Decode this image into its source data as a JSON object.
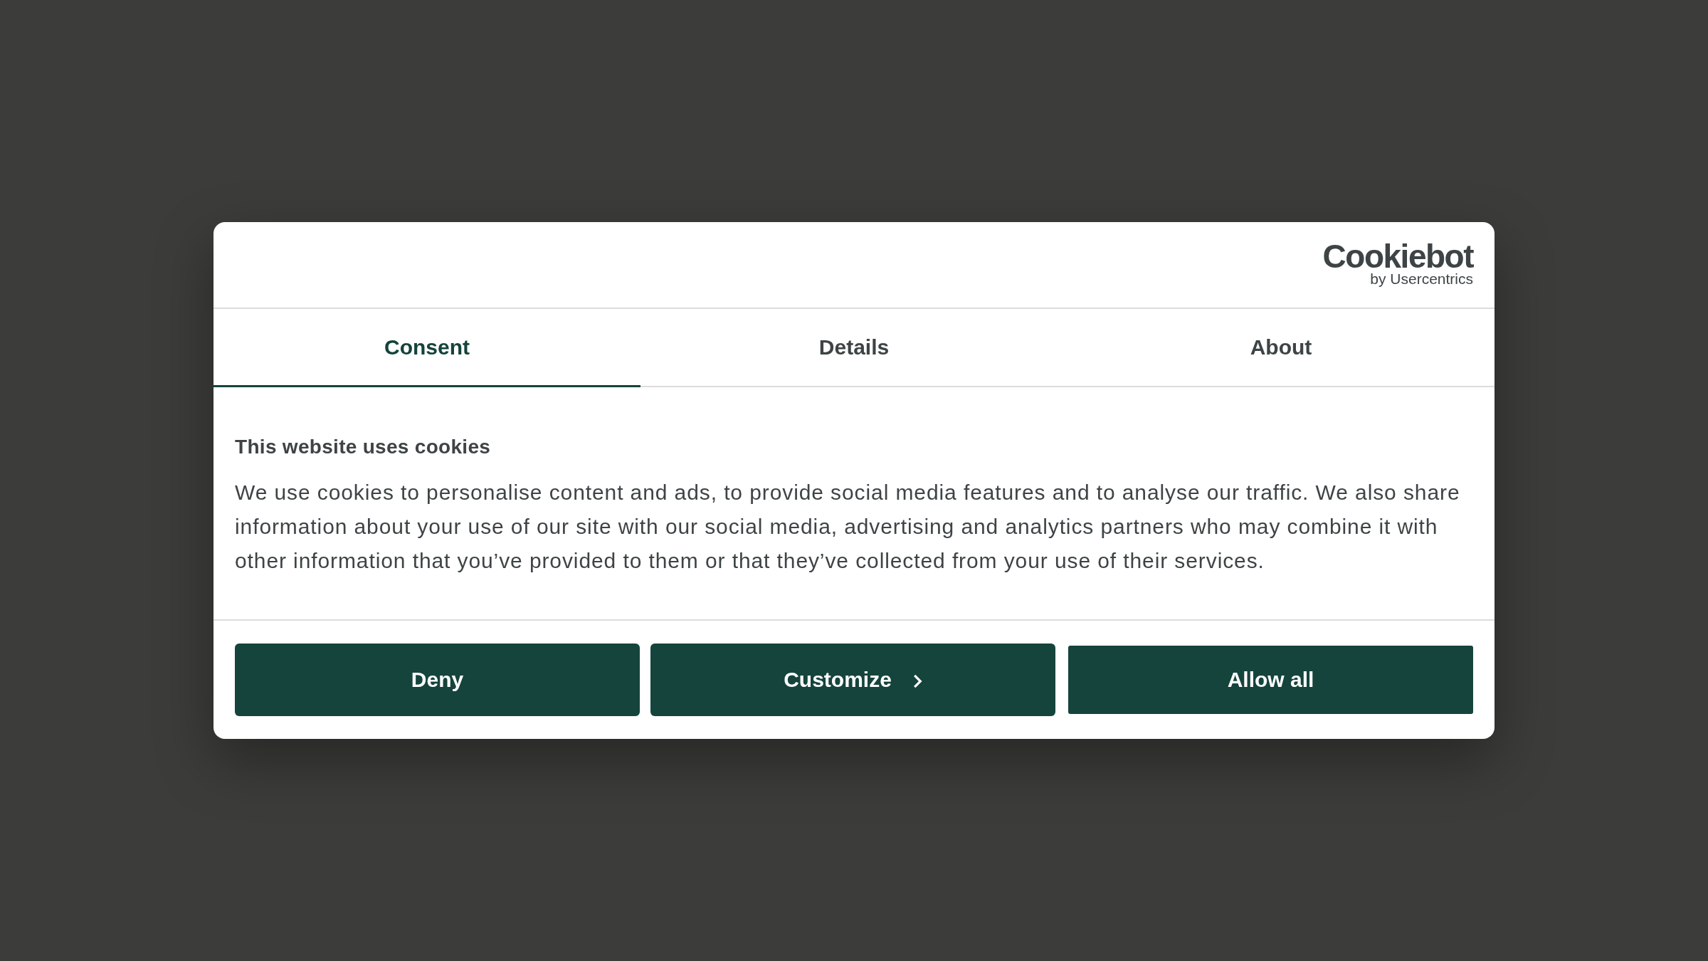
{
  "logo": {
    "wordmark": "Cookiebot",
    "tagline": "by Usercentrics"
  },
  "tabs": [
    {
      "label": "Consent",
      "selected": true
    },
    {
      "label": "Details",
      "selected": false
    },
    {
      "label": "About",
      "selected": false
    }
  ],
  "content": {
    "heading": "This website uses cookies",
    "body": "We use cookies to personalise content and ads, to provide social media features and to analyse our traffic. We also share information about your use of our site with our social media, advertising and analytics partners who may combine it with other information that you’ve provided to them or that they’ve collected from your use of their services."
  },
  "buttons": [
    {
      "label": "Deny",
      "kind": "plain"
    },
    {
      "label": "Customize",
      "kind": "chevron"
    },
    {
      "label": "Allow all",
      "kind": "plain"
    }
  ]
}
